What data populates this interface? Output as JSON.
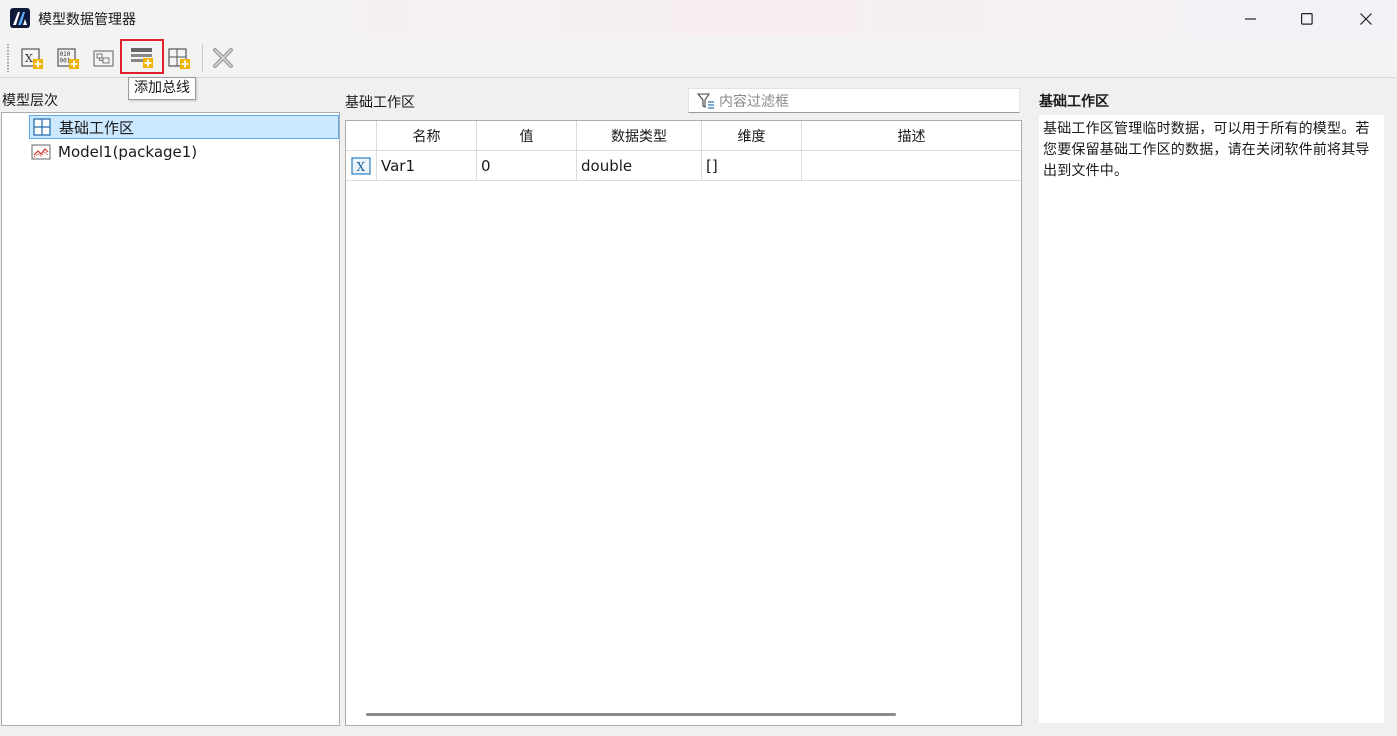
{
  "window": {
    "title": "模型数据管理器",
    "minimize_label": "—",
    "maximize_label": "☐",
    "close_label": "✕"
  },
  "toolbar": {
    "buttons": [
      {
        "icon": "add-variable-icon"
      },
      {
        "icon": "add-binary-data-icon"
      },
      {
        "icon": "add-structure-icon"
      },
      {
        "icon": "add-bus-icon"
      },
      {
        "icon": "add-table-icon"
      },
      {
        "icon": "delete-icon"
      }
    ],
    "tooltip": "添加总线"
  },
  "tree": {
    "label": "模型层次",
    "items": [
      {
        "label": "基础工作区",
        "icon": "workspace-grid-icon",
        "selected": true
      },
      {
        "label": "Model1(package1)",
        "icon": "model-chart-icon",
        "selected": false
      }
    ]
  },
  "workspace": {
    "label": "基础工作区",
    "filter_placeholder": "内容过滤框",
    "columns": [
      "名称",
      "值",
      "数据类型",
      "维度",
      "描述"
    ],
    "rows": [
      {
        "icon": "variable-x-icon",
        "name": "Var1",
        "value": "0",
        "type": "double",
        "dim": "[]",
        "desc": ""
      }
    ]
  },
  "details": {
    "title": "基础工作区",
    "description": "基础工作区管理临时数据，可以用于所有的模型。若您要保留基础工作区的数据，请在关闭软件前将其导出到文件中。"
  },
  "colors": {
    "accent_selected": "#cce8ff",
    "tooltip_highlight": "#e0202a",
    "icon_gold": "#f0b400"
  }
}
